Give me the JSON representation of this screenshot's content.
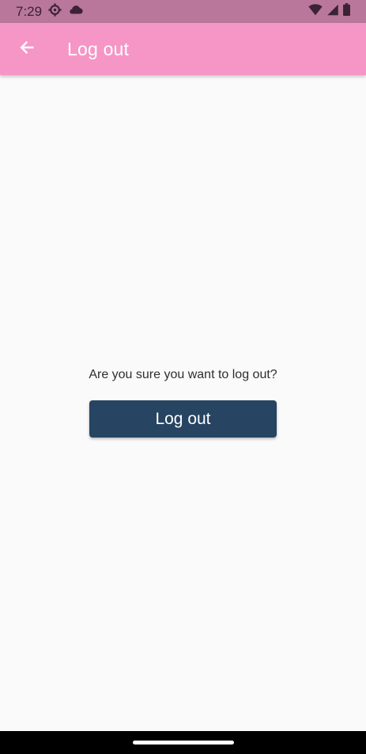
{
  "status_bar": {
    "time": "7:29",
    "left_icons": [
      "settings-gear-icon",
      "cloud-icon"
    ],
    "right_icons": [
      "wifi-icon",
      "cell-signal-icon",
      "battery-icon"
    ]
  },
  "app_bar": {
    "title": "Log out",
    "back_icon": "arrow-left-icon",
    "background_color": "#f596c6"
  },
  "main": {
    "prompt": "Are you sure you want to log out?",
    "logout_button_label": "Log out",
    "logout_button_color": "#274462"
  },
  "colors": {
    "status_bar": "#b9779b",
    "page_background": "#fafafa",
    "nav_bar": "#000000"
  }
}
